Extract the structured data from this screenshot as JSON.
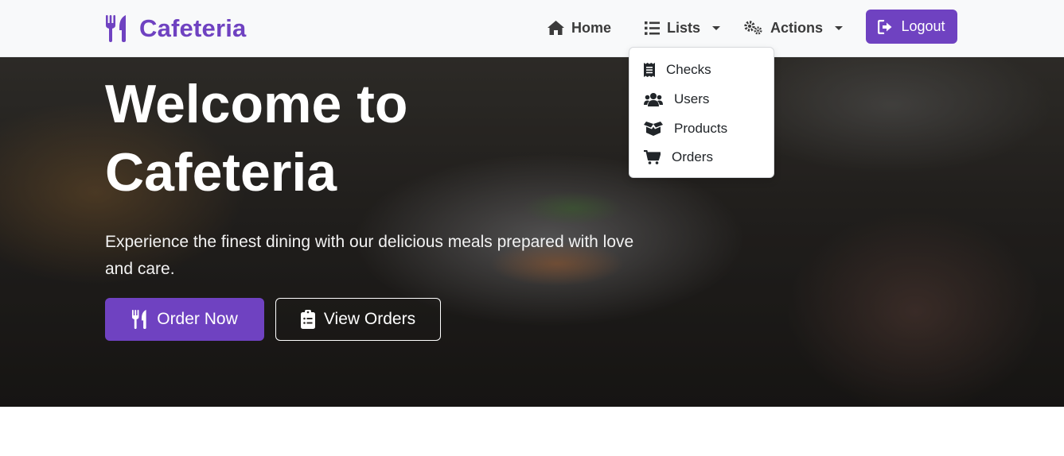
{
  "navbar": {
    "brand_text": "Cafeteria",
    "home_label": "Home",
    "lists_label": "Lists",
    "actions_label": "Actions",
    "logout_label": "Logout"
  },
  "lists_menu": {
    "items": [
      {
        "label": "Checks",
        "icon": "receipt-icon"
      },
      {
        "label": "Users",
        "icon": "users-icon"
      },
      {
        "label": "Products",
        "icon": "box-open-icon"
      },
      {
        "label": "Orders",
        "icon": "shopping-cart-icon"
      }
    ]
  },
  "hero": {
    "title_line1": "Welcome to",
    "title_line2": "Cafeteria",
    "subtitle": "Experience the finest dining with our delicious meals prepared with love and care.",
    "order_button": "Order Now",
    "view_orders_button": "View Orders"
  },
  "colors": {
    "accent": "#6f42c1",
    "navbar_bg": "#f8f9fa"
  }
}
